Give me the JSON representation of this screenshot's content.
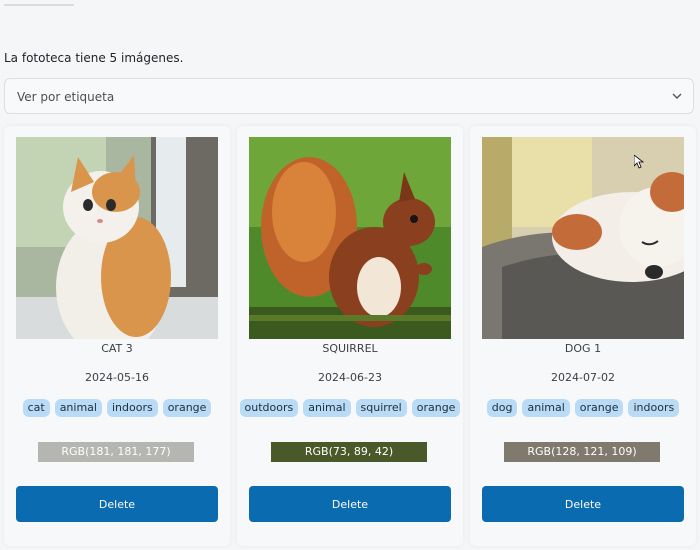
{
  "library": {
    "count_text": "La fototeca tiene 5 imágenes."
  },
  "filter": {
    "label": "Ver por etiqueta",
    "icon": "chevron-down-icon"
  },
  "cards": [
    {
      "name": "CAT 3",
      "date": "2024-05-16",
      "tags": [
        "cat",
        "animal",
        "indoors",
        "orange"
      ],
      "color_label": "RGB(181, 181, 177)",
      "swatch_bg": "#b5b5b1",
      "swatch_fg": "#ffffff",
      "delete_label": "Delete"
    },
    {
      "name": "SQUIRREL",
      "date": "2024-06-23",
      "tags": [
        "outdoors",
        "animal",
        "squirrel",
        "orange"
      ],
      "color_label": "RGB(73, 89, 42)",
      "swatch_bg": "#49592a",
      "swatch_fg": "#ffffff",
      "delete_label": "Delete"
    },
    {
      "name": "DOG 1",
      "date": "2024-07-02",
      "tags": [
        "dog",
        "animal",
        "orange",
        "indoors"
      ],
      "color_label": "RGB(128, 121, 109)",
      "swatch_bg": "#80796d",
      "swatch_fg": "#ffffff",
      "delete_label": "Delete"
    }
  ],
  "colors": {
    "accent": "#0a6bb0",
    "tag_bg": "#b9dbf5",
    "page_bg": "#f5f6f8"
  }
}
